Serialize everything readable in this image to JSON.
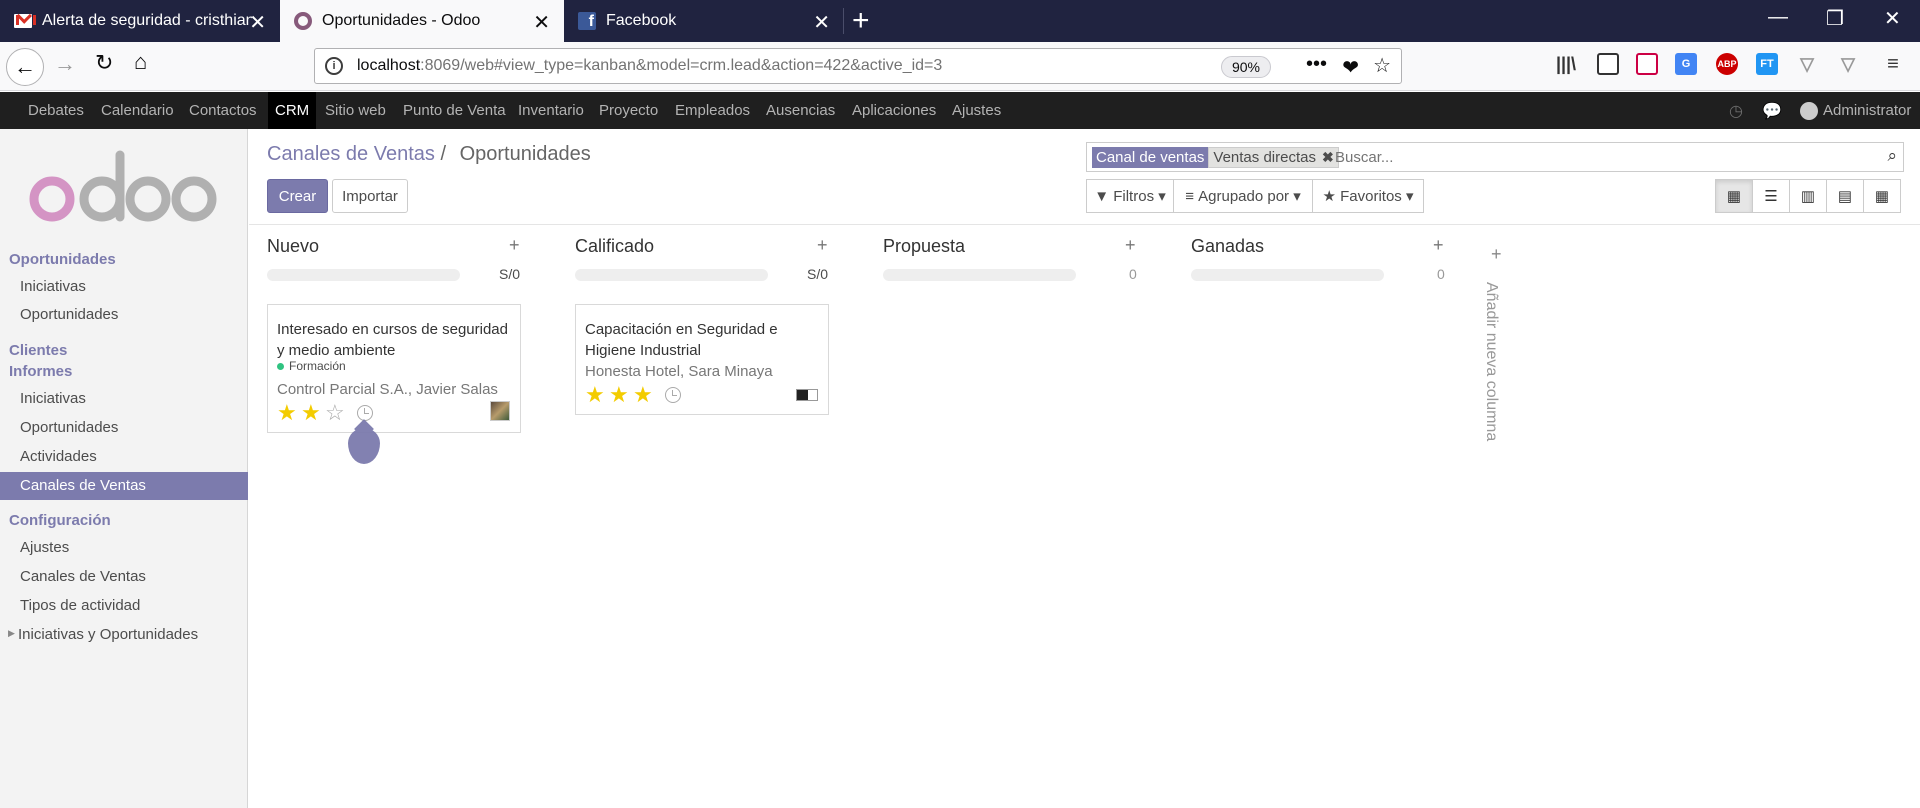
{
  "browser": {
    "tabs": [
      {
        "title": "Alerta de seguridad - cristhiana",
        "favicon": "gmail-icon"
      },
      {
        "title": "Oportunidades - Odoo",
        "favicon": "odoo-icon"
      },
      {
        "title": "Facebook",
        "favicon": "facebook-icon"
      }
    ],
    "url_host": "localhost",
    "url_rest": ":8069/web#view_type=kanban&model=crm.lead&action=422&active_id=3",
    "zoom": "90%",
    "extensions": [
      "library-icon",
      "sidebar-icon",
      "puzzle-icon",
      "translate-icon",
      "adblock-icon",
      "ft-icon",
      "vivaldi-icon",
      "vpn-icon",
      "menu-icon"
    ]
  },
  "menu": {
    "items": [
      "Debates",
      "Calendario",
      "Contactos",
      "CRM",
      "Sitio web",
      "Punto de Venta",
      "Inventario",
      "Proyecto",
      "Empleados",
      "Ausencias",
      "Aplicaciones",
      "Ajustes"
    ],
    "active": "CRM",
    "user": "Administrator"
  },
  "sidebar": {
    "sections": [
      {
        "head": "Oportunidades",
        "items": [
          "Iniciativas",
          "Oportunidades"
        ]
      },
      {
        "head": "Clientes",
        "items": []
      },
      {
        "head": "Informes",
        "items": [
          "Iniciativas",
          "Oportunidades",
          "Actividades",
          "Canales de Ventas"
        ]
      },
      {
        "head": "Configuración",
        "items": [
          "Ajustes",
          "Canales de Ventas",
          "Tipos de actividad"
        ]
      }
    ],
    "collapsible": "Iniciativas y Oportunidades",
    "active_item": "Canales de Ventas"
  },
  "control": {
    "breadcrumb_link": "Canales de Ventas",
    "breadcrumb_sep": "/",
    "breadcrumb_current": "Oportunidades",
    "create": "Crear",
    "import": "Importar",
    "facet_label": "Canal de ventas",
    "facet_value": "Ventas directas",
    "search_placeholder": "Buscar...",
    "filters": "Filtros",
    "group_by": "Agrupado por",
    "favorites": "Favoritos"
  },
  "kanban": {
    "columns": [
      {
        "title": "Nuevo",
        "sum": "S/0",
        "zero_style": false
      },
      {
        "title": "Calificado",
        "sum": "S/0",
        "zero_style": false
      },
      {
        "title": "Propuesta",
        "sum": "0",
        "zero_style": true
      },
      {
        "title": "Ganadas",
        "sum": "0",
        "zero_style": true
      }
    ],
    "cards": [
      {
        "title": "Interesado en cursos de seguridad y medio ambiente",
        "tag": "Formación",
        "customer": "Control Parcial S.A., Javier Salas",
        "stars": 2,
        "max_stars": 3
      },
      {
        "title": "Capacitación en Seguridad e Higiene Industrial",
        "tag": "",
        "customer": "Honesta Hotel, Sara Minaya",
        "stars": 3,
        "max_stars": 3
      }
    ],
    "add_column": "Añadir nueva columna"
  }
}
